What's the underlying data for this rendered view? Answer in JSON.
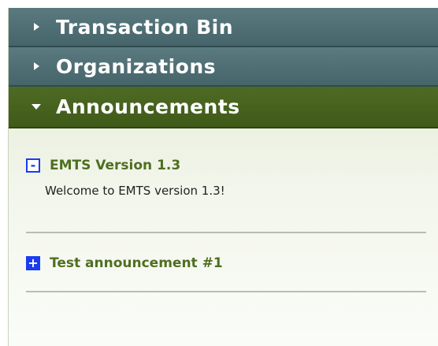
{
  "sections": [
    {
      "label": "Transaction Bin",
      "state": "collapsed"
    },
    {
      "label": "Organizations",
      "state": "collapsed"
    },
    {
      "label": "Announcements",
      "state": "expanded"
    }
  ],
  "announcements": [
    {
      "toggle": "-",
      "title": "EMTS Version 1.3",
      "body": "Welcome to EMTS version 1.3!",
      "expanded": true
    },
    {
      "toggle": "+",
      "title": "Test announcement #1",
      "body": "",
      "expanded": false
    }
  ],
  "colors": {
    "collapsed_header": "#4f6f75",
    "expanded_header": "#46621c",
    "announcement_title": "#4f6f20",
    "toggle_blue": "#1a3cf0"
  },
  "icons": {
    "collapsed_caret": "caret-right-icon",
    "expanded_caret": "caret-down-icon"
  }
}
